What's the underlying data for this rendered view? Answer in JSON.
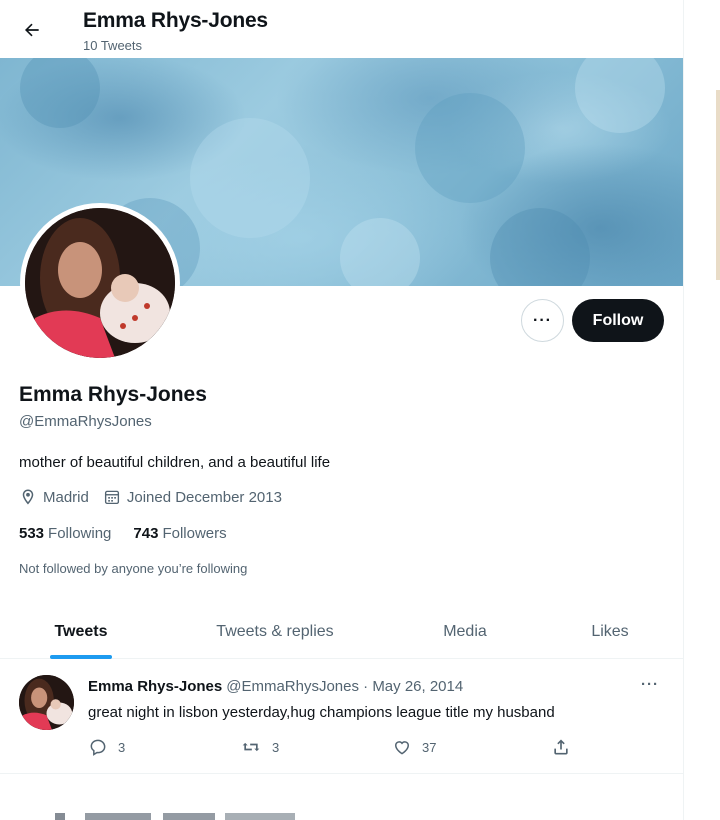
{
  "header": {
    "name": "Emma Rhys-Jones",
    "tweet_count": "10 Tweets"
  },
  "profile": {
    "name": "Emma Rhys-Jones",
    "handle": "@EmmaRhysJones",
    "bio": "mother of beautiful children, and a beautiful life",
    "location": "Madrid",
    "joined": "Joined December 2013",
    "following_count": "533",
    "following_label": "Following",
    "followers_count": "743",
    "followers_label": "Followers",
    "not_followed": "Not followed by anyone you’re following",
    "more_label": "···",
    "follow_label": "Follow"
  },
  "tabs": [
    {
      "label": "Tweets",
      "active": true
    },
    {
      "label": "Tweets & replies",
      "active": false
    },
    {
      "label": "Media",
      "active": false
    },
    {
      "label": "Likes",
      "active": false
    }
  ],
  "tweet": {
    "author": "Emma Rhys-Jones",
    "handle_date": "@EmmaRhysJones · May 26, 2014",
    "text": "great night in lisbon yesterday,hug champions league title my husband",
    "more": "···",
    "replies": "3",
    "retweets": "3",
    "likes": "37"
  },
  "colors": {
    "accent": "#1d9bf0",
    "text_primary": "#0f1419",
    "text_secondary": "#536471",
    "follow_bg": "#0f1419"
  },
  "icons": {
    "back": "arrow-left-icon",
    "location": "location-pin-icon",
    "calendar": "calendar-icon",
    "reply": "reply-icon",
    "retweet": "retweet-icon",
    "like": "heart-icon",
    "share": "share-icon"
  }
}
